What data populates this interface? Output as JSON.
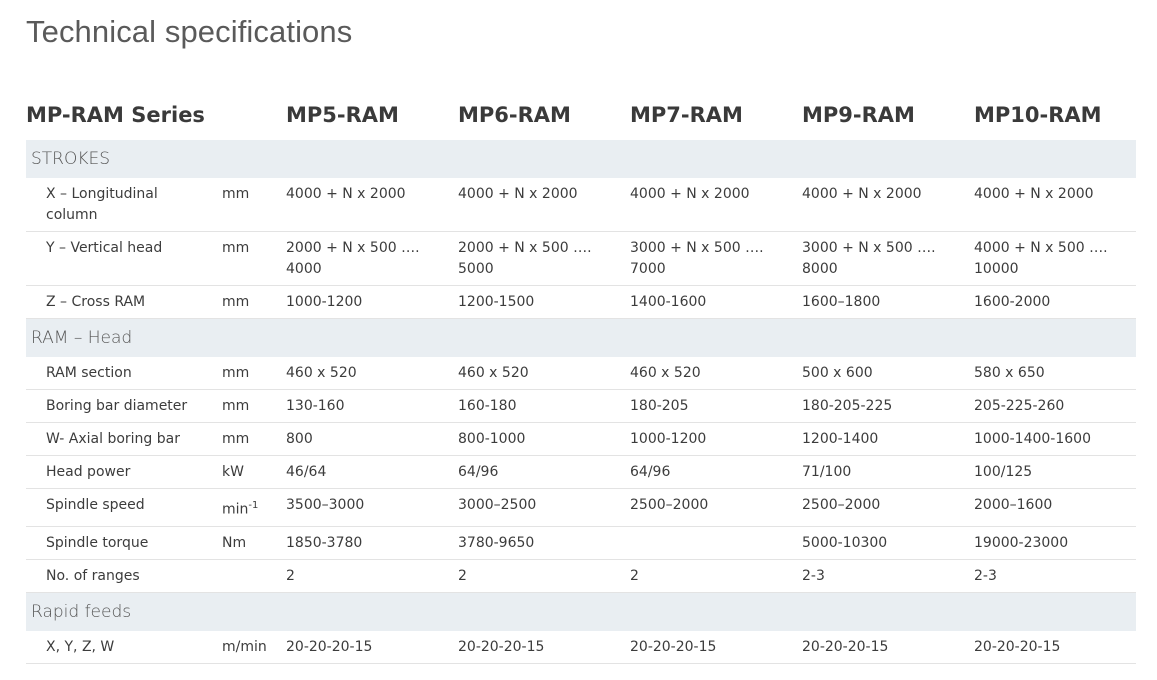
{
  "title": "Technical specifications",
  "table": {
    "series_label": "MP-RAM Series",
    "models": [
      "MP5-RAM",
      "MP6-RAM",
      "MP7-RAM",
      "MP9-RAM",
      "MP10-RAM"
    ],
    "sections": [
      {
        "name": "STROKES",
        "rows": [
          {
            "label": "X – Longitudinal column",
            "unit": "mm",
            "unit_sup": "",
            "values": [
              "4000 + N x 2000",
              "4000 + N x 2000",
              "4000 + N x 2000",
              "4000 + N x 2000",
              "4000 + N x 2000"
            ]
          },
          {
            "label": "Y – Vertical head",
            "unit": "mm",
            "unit_sup": "",
            "values": [
              "2000 + N x 500 ….\n4000",
              "2000 + N x 500 ….\n5000",
              "3000 + N x 500 ….\n7000",
              "3000 + N x 500 …. 8000",
              "4000 + N x 500 …. 10000"
            ]
          },
          {
            "label": "Z – Cross RAM",
            "unit": "mm",
            "unit_sup": "",
            "values": [
              "1000-1200",
              "1200-1500",
              "1400-1600",
              "1600–1800",
              "1600-2000"
            ]
          }
        ]
      },
      {
        "name": "RAM – Head",
        "rows": [
          {
            "label": "RAM section",
            "unit": "mm",
            "unit_sup": "",
            "values": [
              "460 x 520",
              "460 x 520",
              "460 x 520",
              "500 x 600",
              "580 x 650"
            ]
          },
          {
            "label": "Boring bar diameter",
            "unit": "mm",
            "unit_sup": "",
            "values": [
              "130-160",
              "160-180",
              "180-205",
              "180-205-225",
              "205-225-260"
            ]
          },
          {
            "label": "W- Axial boring bar",
            "unit": "mm",
            "unit_sup": "",
            "values": [
              "800",
              "800-1000",
              "1000-1200",
              "1200-1400",
              "1000-1400-1600"
            ]
          },
          {
            "label": "Head power",
            "unit": "kW",
            "unit_sup": "",
            "values": [
              "46/64",
              "64/96",
              "64/96",
              "71/100",
              "100/125"
            ]
          },
          {
            "label": "Spindle speed",
            "unit": "min",
            "unit_sup": "-1",
            "values": [
              "3500–3000",
              "3000–2500",
              "2500–2000",
              "2500–2000",
              "2000–1600"
            ]
          },
          {
            "label": "Spindle torque",
            "unit": "Nm",
            "unit_sup": "",
            "values": [
              "1850-3780",
              "3780-9650",
              "",
              "5000-10300",
              "19000-23000"
            ]
          },
          {
            "label": "No. of ranges",
            "unit": "",
            "unit_sup": "",
            "values": [
              "2",
              "2",
              "2",
              "2-3",
              "2-3"
            ]
          }
        ]
      },
      {
        "name": "Rapid feeds",
        "rows": [
          {
            "label": "X, Y, Z, W",
            "unit": "m/min",
            "unit_sup": "",
            "values": [
              "20-20-20-15",
              "20-20-20-15",
              "20-20-20-15",
              "20-20-20-15",
              "20-20-20-15"
            ]
          }
        ]
      }
    ]
  }
}
